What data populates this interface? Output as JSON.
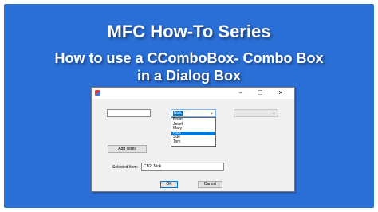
{
  "header": {
    "title": "MFC How-To Series",
    "subtitle_line1": "How to use a CComboBox- Combo Box",
    "subtitle_line2": "in a Dialog Box"
  },
  "dialog": {
    "titlebar": {
      "minimize_glyph": "–",
      "maximize_glyph": "☐",
      "close_glyph": "✕"
    },
    "combo1": {
      "selected_value": "Nick",
      "arrow_glyph": "⌄",
      "options": [
        "Brian",
        "Josef",
        "Mary",
        "Nick",
        "Sue",
        "Tom"
      ],
      "selected_index": 3
    },
    "combo2": {
      "arrow_glyph": "⌄"
    },
    "add_button_label": "Add Items",
    "selected_item_label": "Selected Item:",
    "selected_item_value": "CB2: Nick",
    "ok_label": "OK",
    "cancel_label": "Cancel"
  },
  "colors": {
    "banner_background": "#2a6fd6",
    "selection_highlight": "#0078d7"
  }
}
